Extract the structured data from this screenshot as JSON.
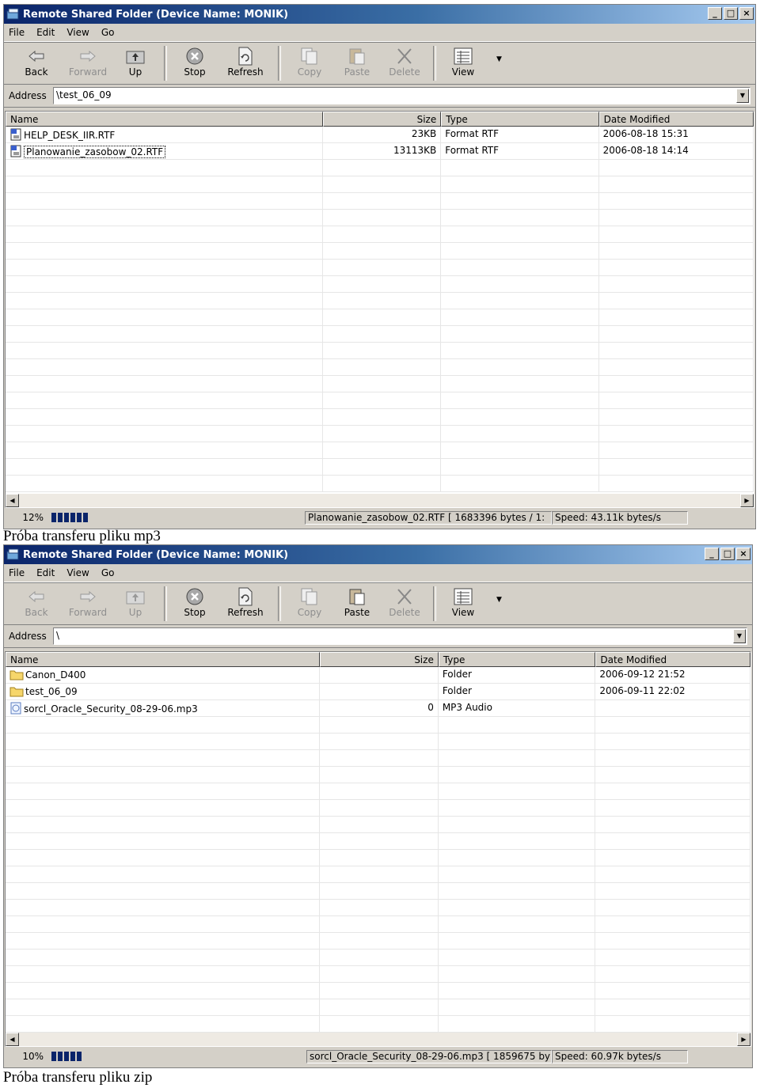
{
  "windows": [
    {
      "title": "Remote Shared Folder (Device Name: MONIK)",
      "menu": [
        "File",
        "Edit",
        "View",
        "Go"
      ],
      "toolbar": {
        "back": {
          "label": "Back",
          "icon": "back-arrow-icon"
        },
        "forward": {
          "label": "Forward",
          "icon": "forward-arrow-icon"
        },
        "up": {
          "label": "Up",
          "icon": "up-folder-icon"
        },
        "stop": {
          "label": "Stop",
          "icon": "stop-icon"
        },
        "refresh": {
          "label": "Refresh",
          "icon": "refresh-icon"
        },
        "copy": {
          "label": "Copy",
          "icon": "copy-icon"
        },
        "paste": {
          "label": "Paste",
          "icon": "paste-icon"
        },
        "delete": {
          "label": "Delete",
          "icon": "delete-icon"
        },
        "view": {
          "label": "View",
          "icon": "view-icon"
        }
      },
      "address": {
        "label": "Address",
        "value": "\\test_06_09"
      },
      "columns": {
        "name": "Name",
        "size": "Size",
        "type": "Type",
        "date": "Date Modified"
      },
      "files": [
        {
          "name": "HELP_DESK_IIR.RTF",
          "size": "23KB",
          "type": "Format RTF",
          "date": "2006-08-18 15:31",
          "icon": "rtf-document-icon"
        },
        {
          "name": "Planowanie_zasobow_02.RTF",
          "size": "13113KB",
          "type": "Format RTF",
          "date": "2006-08-18 14:14",
          "icon": "rtf-document-icon"
        }
      ],
      "status": {
        "percent": "12%",
        "progress": 0.12,
        "transfer": "Planowanie_zasobow_02.RTF [ 1683396 bytes / 1:",
        "speed": "Speed: 43.11k bytes/s"
      }
    },
    {
      "title": "Remote Shared Folder (Device Name: MONIK)",
      "menu": [
        "File",
        "Edit",
        "View",
        "Go"
      ],
      "toolbar": {
        "back": {
          "label": "Back",
          "icon": "back-arrow-icon"
        },
        "forward": {
          "label": "Forward",
          "icon": "forward-arrow-icon"
        },
        "up": {
          "label": "Up",
          "icon": "up-folder-icon"
        },
        "stop": {
          "label": "Stop",
          "icon": "stop-icon"
        },
        "refresh": {
          "label": "Refresh",
          "icon": "refresh-icon"
        },
        "copy": {
          "label": "Copy",
          "icon": "copy-icon"
        },
        "paste": {
          "label": "Paste",
          "icon": "paste-icon"
        },
        "delete": {
          "label": "Delete",
          "icon": "delete-icon"
        },
        "view": {
          "label": "View",
          "icon": "view-icon"
        }
      },
      "address": {
        "label": "Address",
        "value": "\\"
      },
      "columns": {
        "name": "Name",
        "size": "Size",
        "type": "Type",
        "date": "Date Modified"
      },
      "files": [
        {
          "name": "Canon_D400",
          "size": "",
          "type": "Folder",
          "date": "2006-09-12 21:52",
          "icon": "folder-icon"
        },
        {
          "name": "test_06_09",
          "size": "",
          "type": "Folder",
          "date": "2006-09-11 22:02",
          "icon": "folder-icon"
        },
        {
          "name": "sorcl_Oracle_Security_08-29-06.mp3",
          "size": "0",
          "type": "MP3 Audio",
          "date": "",
          "icon": "audio-file-icon"
        }
      ],
      "status": {
        "percent": "10%",
        "progress": 0.1,
        "transfer": "sorcl_Oracle_Security_08-29-06.mp3 [ 1859675 by",
        "speed": "Speed: 60.97k bytes/s"
      }
    }
  ],
  "captions": [
    "Próba transferu pliku mp3",
    "Próba transferu pliku zip"
  ],
  "colors": {
    "title_start": "#0a246a",
    "title_end": "#a6caf0",
    "window_bg": "#d4d0c8",
    "progress": "#0a246a"
  }
}
